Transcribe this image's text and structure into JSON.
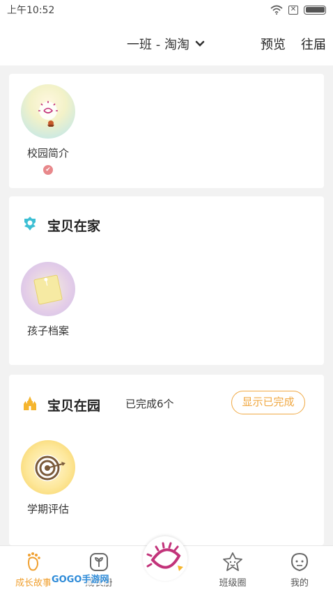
{
  "status_bar": {
    "time": "上午10:52"
  },
  "header": {
    "class_selector": "一班 - 淘淘",
    "preview_label": "预览",
    "past_label": "往届"
  },
  "section_intro": {
    "tiles": [
      {
        "label": "校园简介"
      }
    ]
  },
  "section_home": {
    "title": "宝贝在家",
    "tiles": [
      {
        "label": "孩子档案"
      }
    ]
  },
  "section_school": {
    "title": "宝贝在园",
    "completed_count": "已完成6个",
    "show_completed_label": "显示已完成",
    "tiles": [
      {
        "label": "学期评估"
      }
    ]
  },
  "bottom_nav": {
    "items": [
      {
        "label": "成长故事",
        "icon": "footprint-icon",
        "active": true
      },
      {
        "label": "成长册",
        "icon": "sprout-icon",
        "active": false
      },
      {
        "label": "",
        "icon": "record-center-icon",
        "active": false
      },
      {
        "label": "班级圈",
        "icon": "star-face-icon",
        "active": false
      },
      {
        "label": "我的",
        "icon": "person-face-icon",
        "active": false
      }
    ],
    "watermark": "GOGO手游网"
  },
  "colors": {
    "accent": "#f0a842",
    "badge": "#e8888b",
    "home_icon": "#3dbfd4",
    "school_icon": "#f5b52e"
  }
}
